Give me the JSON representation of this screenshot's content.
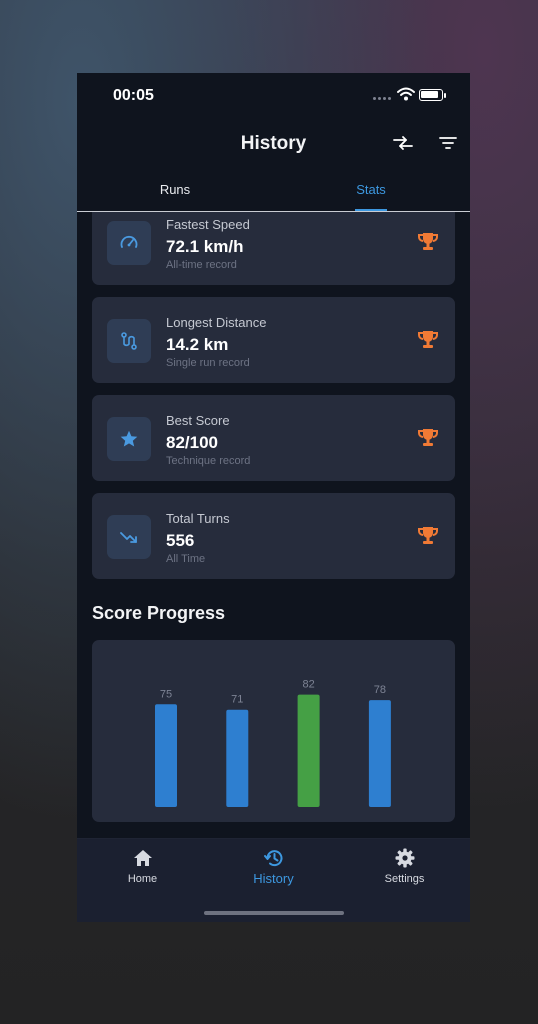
{
  "status_bar": {
    "time": "00:05"
  },
  "header": {
    "title": "History",
    "compare_icon": "compare-arrows-icon",
    "filter_icon": "filter-icon"
  },
  "tabs": [
    {
      "label": "Runs",
      "active": false
    },
    {
      "label": "Stats",
      "active": true
    }
  ],
  "records": [
    {
      "icon": "speedometer-icon",
      "label": "Fastest Speed",
      "value": "72.1 km/h",
      "sub": "All-time record"
    },
    {
      "icon": "route-icon",
      "label": "Longest Distance",
      "value": "14.2 km",
      "sub": "Single run record"
    },
    {
      "icon": "star-icon",
      "label": "Best Score",
      "value": "82/100",
      "sub": "Technique record"
    },
    {
      "icon": "trending-down-icon",
      "label": "Total Turns",
      "value": "556",
      "sub": "All Time"
    }
  ],
  "score_progress": {
    "title": "Score Progress"
  },
  "chart_data": {
    "type": "bar",
    "title": "",
    "series": [
      {
        "values": [
          75,
          71,
          82,
          78
        ]
      }
    ],
    "data_labels": [
      "75",
      "71",
      "82",
      "78"
    ],
    "highlight_index": 2,
    "colors": {
      "default": "#2e7fd0",
      "highlight": "#45a045"
    }
  },
  "nav": [
    {
      "icon": "home-icon",
      "label": "Home",
      "active": false
    },
    {
      "icon": "history-icon",
      "label": "History",
      "active": true
    },
    {
      "icon": "gear-icon",
      "label": "Settings",
      "active": false
    }
  ],
  "colors": {
    "accent": "#3d98e0",
    "trophy": "#f07a35",
    "card": "#262c3c",
    "background": "#0f141e"
  }
}
